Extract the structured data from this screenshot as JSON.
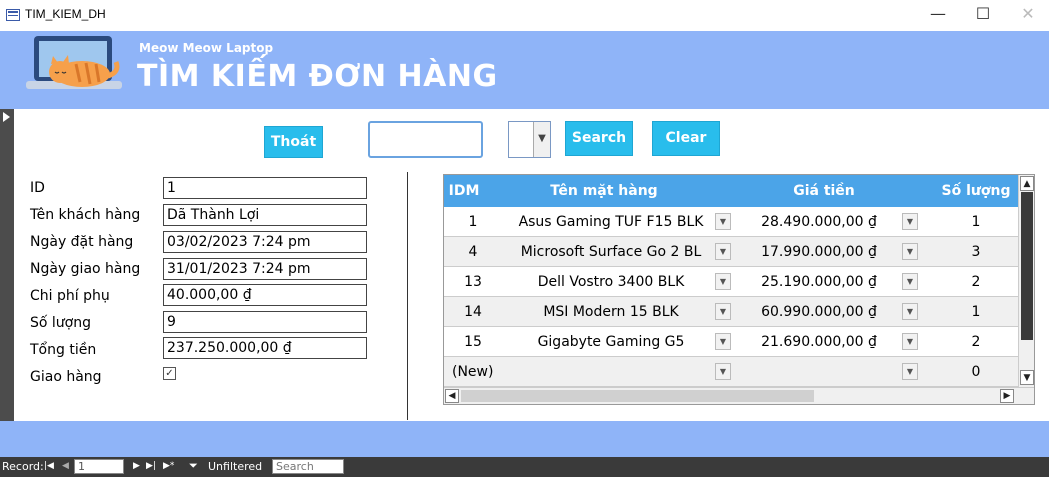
{
  "window": {
    "title": "TIM_KIEM_DH",
    "minimize_glyph": "—",
    "maximize_glyph": "☐",
    "close_glyph": "✕"
  },
  "header": {
    "brand": "Meow Meow Laptop",
    "title": "TÌM KIẾM ĐƠN HÀNG",
    "background_color": "#8fb4f8"
  },
  "toolbar": {
    "exit_label": "Thoát",
    "search_label": "Search",
    "clear_label": "Clear",
    "search_value": "",
    "combo_value": "",
    "accent_color": "#29bdec"
  },
  "form": {
    "fields": [
      {
        "label": "ID",
        "value": "1"
      },
      {
        "label": "Tên khách hàng",
        "value": "Dã Thành Lợi"
      },
      {
        "label": "Ngày đặt hàng",
        "value": "03/02/2023 7:24 pm"
      },
      {
        "label": "Ngày giao hàng",
        "value": "31/01/2023 7:24 pm"
      },
      {
        "label": "Chi phí phụ",
        "value": "40.000,00 ₫"
      },
      {
        "label": "Số lượng",
        "value": "9"
      },
      {
        "label": "Tổng tiền",
        "value": "237.250.000,00 ₫"
      }
    ],
    "delivered_label": "Giao hàng",
    "delivered_checked": true
  },
  "grid": {
    "columns": [
      "IDM",
      "Tên mặt hàng",
      "Giá tiền",
      "Số lượng"
    ],
    "rows": [
      {
        "idm": "1",
        "name": "Asus Gaming TUF F15 BLK",
        "price": "28.490.000,00 ₫",
        "qty": "1"
      },
      {
        "idm": "4",
        "name": "Microsoft Surface Go 2 BL",
        "price": "17.990.000,00 ₫",
        "qty": "3"
      },
      {
        "idm": "13",
        "name": "Dell Vostro 3400 BLK",
        "price": "25.190.000,00 ₫",
        "qty": "2"
      },
      {
        "idm": "14",
        "name": "MSI Modern 15 BLK",
        "price": "60.990.000,00 ₫",
        "qty": "1"
      },
      {
        "idm": "15",
        "name": "Gigabyte Gaming G5",
        "price": "21.690.000,00 ₫",
        "qty": "2"
      }
    ],
    "new_row": {
      "label": "(New)",
      "qty": "0"
    },
    "header_color": "#4ba4e8"
  },
  "navbar": {
    "record_label": "Record:",
    "record_value": "1",
    "filter_label": "Unfiltered",
    "search_placeholder": "Search",
    "first_glyph": "|◀",
    "prev_glyph": "◀",
    "next_glyph": "▶",
    "last_glyph": "▶|",
    "new_glyph": "▶*"
  }
}
